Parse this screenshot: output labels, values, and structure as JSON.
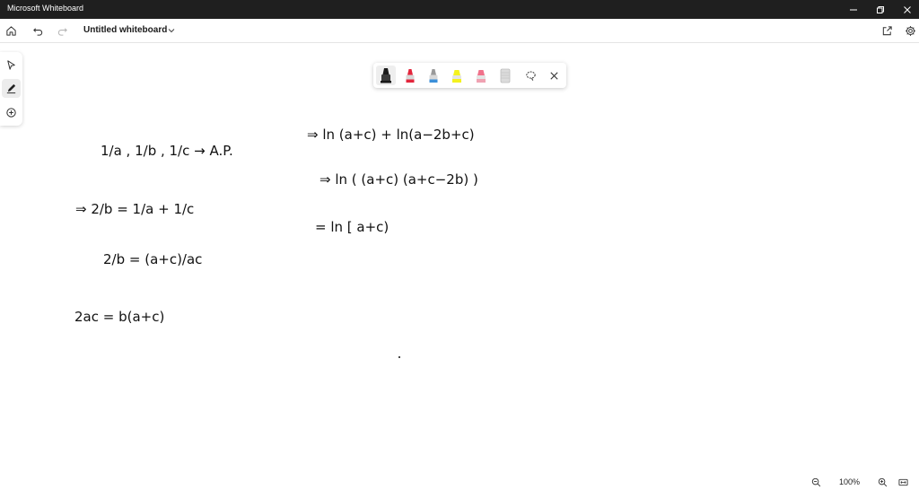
{
  "window": {
    "title": "Microsoft Whiteboard"
  },
  "appbar": {
    "board_title": "Untitled whiteboard"
  },
  "zoom": {
    "level": "100%"
  },
  "icons": {
    "home": "home-icon",
    "undo": "undo-icon",
    "redo": "redo-icon",
    "share": "share-icon",
    "settings": "gear-icon",
    "select": "pointer-icon",
    "ink": "pen-icon",
    "add": "plus-circle-icon",
    "lasso": "lasso-icon",
    "close": "close-icon",
    "zoom_out": "zoom-out-icon",
    "zoom_in": "zoom-in-icon",
    "fit": "fit-screen-icon"
  },
  "pens": [
    {
      "name": "black-pen",
      "color": "#1a1a1a",
      "active": true
    },
    {
      "name": "red-pen",
      "color": "#e3263c"
    },
    {
      "name": "blue-pen",
      "color": "#3b8fd9"
    },
    {
      "name": "yellow-highlighter",
      "color": "#f4f21f"
    },
    {
      "name": "pink-highlighter",
      "color": "#f0718a"
    },
    {
      "name": "eraser",
      "color": "#d9d9d9"
    }
  ],
  "ink": {
    "l1": "1/a , 1/b , 1/c  →  A.P.",
    "l2": "⇒   2/b  =  1/a  +  1/c",
    "l3": "2/b  =  (a+c)/ac",
    "l4": "2ac  =  b(a+c)",
    "r1": "⇒   ln (a+c)  +  ln(a−2b+c)",
    "r2": "⇒   ln (  (a+c) (a+c−2b) )",
    "r3": "= ln [   a+c)"
  }
}
